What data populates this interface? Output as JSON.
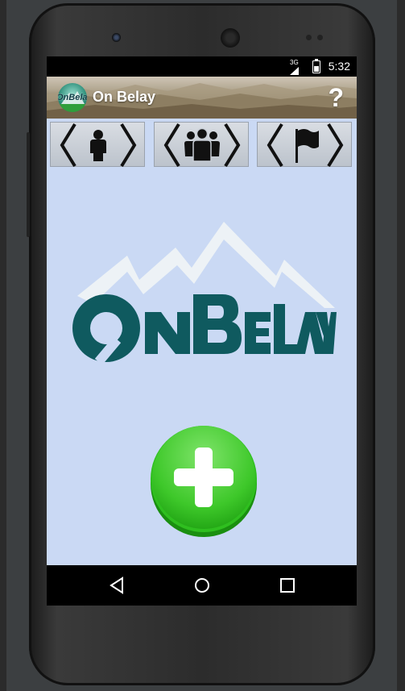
{
  "status_bar": {
    "network_label": "3G",
    "time": "5:32",
    "battery_level_percent": 50
  },
  "action_bar": {
    "logo_text": "OnBelay",
    "title": "On Belay",
    "help_glyph": "?"
  },
  "tabs": [
    {
      "name": "single-climber",
      "icon": "person-icon"
    },
    {
      "name": "group",
      "icon": "group-icon"
    },
    {
      "name": "route",
      "icon": "flag-icon"
    }
  ],
  "main": {
    "logo_wordmark": "OnBelay",
    "add_button_icon": "plus-icon"
  },
  "nav": {
    "back_icon": "back-triangle-icon",
    "home_icon": "home-circle-icon",
    "recents_icon": "recents-square-icon"
  },
  "colors": {
    "content_background": "#cad9f4",
    "logo_teal": "#0f5a5f",
    "add_button_green": "#2fbf1f"
  }
}
